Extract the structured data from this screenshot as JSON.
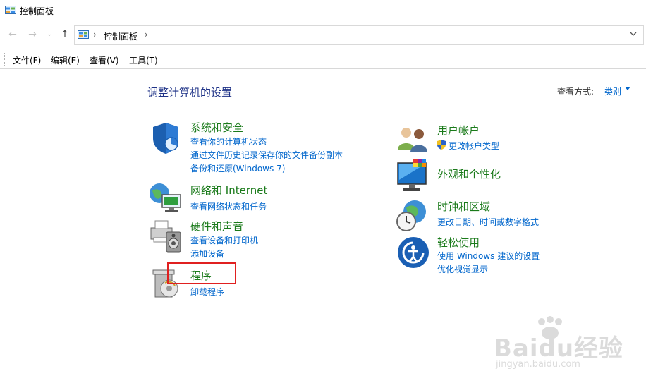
{
  "window": {
    "title": "控制面板",
    "icon": "control-panel-icon"
  },
  "nav": {
    "back_icon": "arrow-left-icon",
    "forward_icon": "arrow-right-icon",
    "recent_icon": "chevron-down-icon",
    "up_icon": "arrow-up-icon",
    "address": {
      "crumb": "控制面板",
      "separator": "›",
      "dropdown_icon": "chevron-down-icon"
    }
  },
  "menu": [
    {
      "label": "文件(F)"
    },
    {
      "label": "编辑(E)"
    },
    {
      "label": "查看(V)"
    },
    {
      "label": "工具(T)"
    }
  ],
  "main": {
    "heading": "调整计算机的设置",
    "view_by_label": "查看方式:",
    "view_by_value": "类别"
  },
  "categories": [
    {
      "title": "系统和安全",
      "icon": "shield-icon",
      "links": [
        "查看你的计算机状态",
        "通过文件历史记录保存你的文件备份副本",
        "备份和还原(Windows 7)"
      ]
    },
    {
      "title": "网络和 Internet",
      "icon": "network-globe-icon",
      "links": [
        "查看网络状态和任务"
      ]
    },
    {
      "title": "硬件和声音",
      "icon": "printer-speaker-icon",
      "links": [
        "查看设备和打印机",
        "添加设备"
      ]
    },
    {
      "title": "程序",
      "icon": "programs-disc-icon",
      "links": [
        "卸载程序"
      ]
    },
    {
      "title": "用户帐户",
      "icon": "users-icon",
      "links": [
        "更改帐户类型"
      ]
    },
    {
      "title": "外观和个性化",
      "icon": "monitor-palette-icon",
      "links": []
    },
    {
      "title": "时钟和区域",
      "icon": "clock-globe-icon",
      "links": [
        "更改日期、时间或数字格式"
      ]
    },
    {
      "title": "轻松使用",
      "icon": "ease-of-access-icon",
      "links": [
        "使用 Windows 建议的设置",
        "优化视觉显示"
      ]
    }
  ],
  "watermark": {
    "logo": "Baidu经验",
    "url": "jingyan.baidu.com"
  },
  "colors": {
    "heading": "#1e3287",
    "category_title": "#1a7a1a",
    "link": "#0066cc",
    "highlight": "#e02020"
  }
}
